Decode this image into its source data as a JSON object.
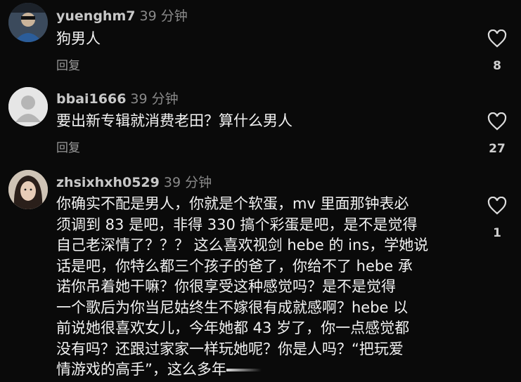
{
  "comments": [
    {
      "username": "yuenghm7",
      "time": "39 分钟",
      "text_lines": [
        "狗男人"
      ],
      "reply_label": "回复",
      "like_count": "8",
      "avatar_icon": "user-photo-avatar"
    },
    {
      "username": "bbai1666",
      "time": "39 分钟",
      "text_lines": [
        "要出新专辑就消费老田？算什么男人"
      ],
      "reply_label": "回复",
      "like_count": "27",
      "avatar_icon": "default-person-avatar"
    },
    {
      "username": "zhsixhxh0529",
      "time": "39 分钟",
      "text_lines": [
        "你确实不配是男人，你就是个软蛋，mv 里面那钟表必",
        "须调到 83 是吧，非得 330 搞个彩蛋是吧，是不是觉得",
        "自己老深情了？？？ 这么喜欢视剑 hebe 的 ins，学她说",
        "话是吧，你特么都三个孩子的爸了，你给不了 hebe 承",
        "诺你吊着她干嘛？你很享受这种感觉吗？是不是觉得",
        "一个歌后为你当尼姑终生不嫁很有成就感啊？hebe 以",
        "前说她很喜欢女儿，今年她都 43 岁了，你一点感觉都",
        "没有吗？还跟过家家一样玩她呢？你是人吗？“把玩爱",
        "情游戏的高手”，这么多年"
      ],
      "like_count": "1",
      "avatar_icon": "woman-photo-avatar"
    }
  ],
  "icons": {
    "like": "heart-outline-icon"
  },
  "colors": {
    "background": "#0a0a0a",
    "username": "#c8c8c8",
    "meta": "#9a9a9a",
    "text": "#f2f2f2"
  }
}
